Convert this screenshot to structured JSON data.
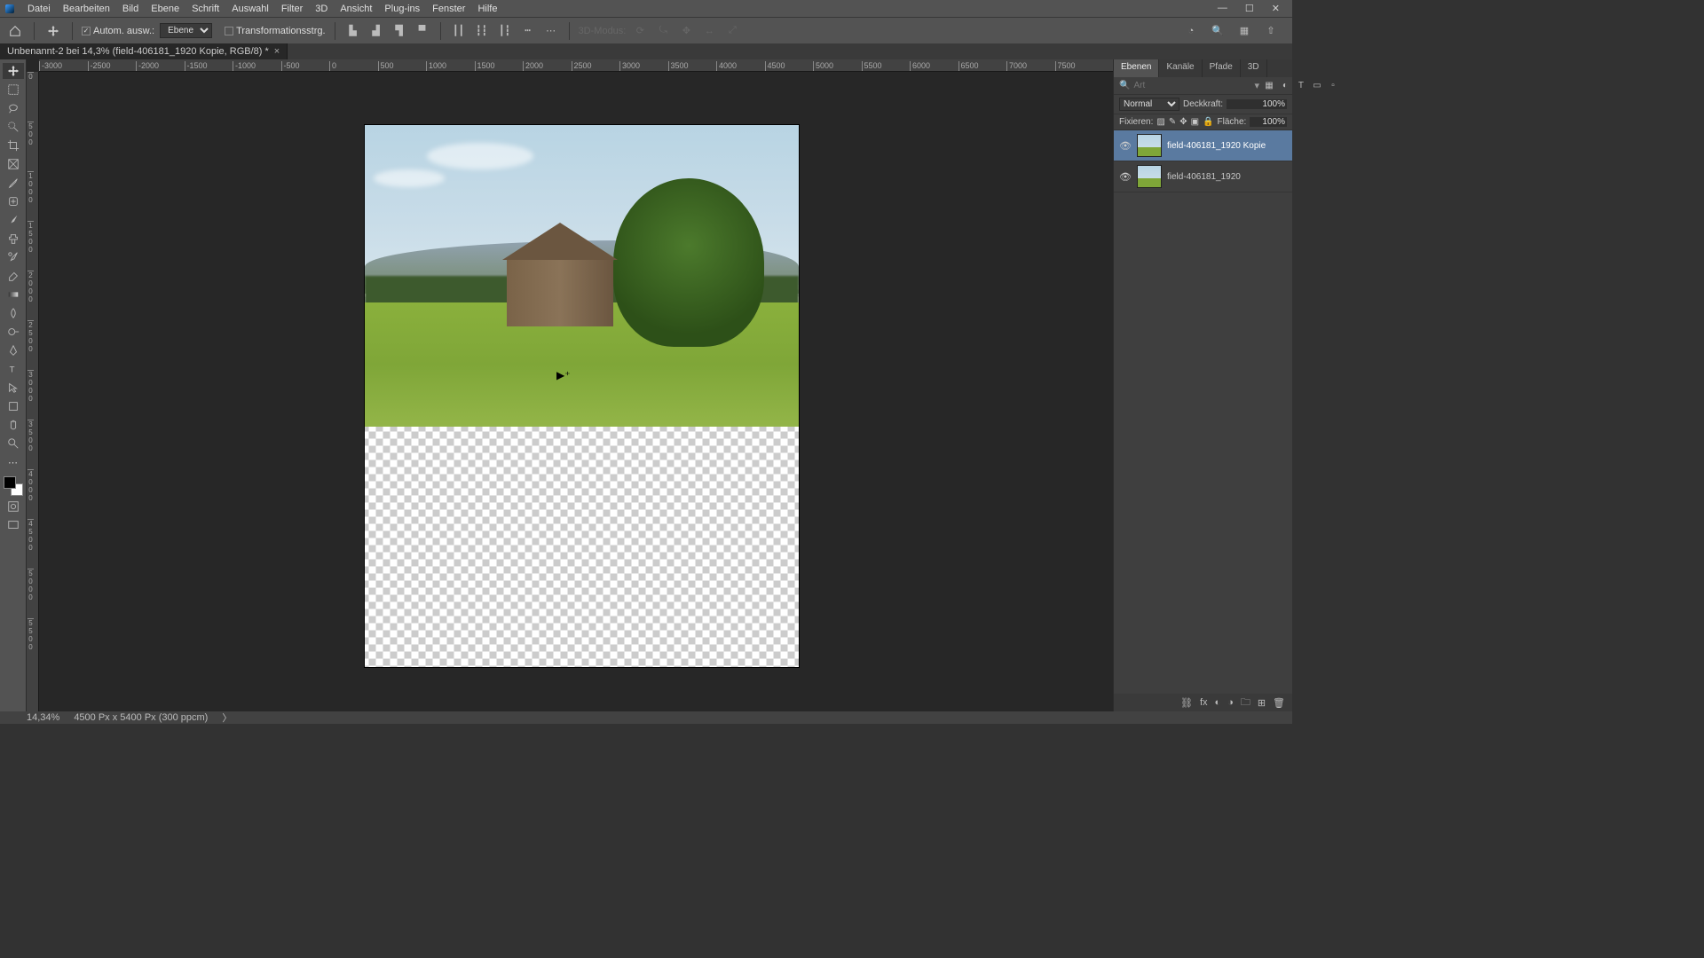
{
  "menu": {
    "items": [
      "Datei",
      "Bearbeiten",
      "Bild",
      "Ebene",
      "Schrift",
      "Auswahl",
      "Filter",
      "3D",
      "Ansicht",
      "Plug-ins",
      "Fenster",
      "Hilfe"
    ]
  },
  "options": {
    "auto_select_label": "Autom. ausw.:",
    "auto_select_target": "Ebene",
    "transform_ctrls_label": "Transformationsstrg.",
    "mode3d_label": "3D-Modus:"
  },
  "doc": {
    "tab_title": "Unbenannt-2 bei 14,3% (field-406181_1920 Kopie, RGB/8) *"
  },
  "ruler_h": [
    "-3000",
    "-2500",
    "-2000",
    "-1500",
    "-1000",
    "-500",
    "0",
    "500",
    "1000",
    "1500",
    "2000",
    "2500",
    "3000",
    "3500",
    "4000",
    "4500",
    "5000",
    "5500",
    "6000",
    "6500",
    "7000",
    "7500"
  ],
  "ruler_v": [
    "0",
    "500",
    "1000",
    "1500",
    "2000",
    "2500",
    "3000",
    "3500",
    "4000",
    "4500",
    "5000",
    "5500"
  ],
  "panels": {
    "tabs": [
      "Ebenen",
      "Kanäle",
      "Pfade",
      "3D"
    ],
    "search_placeholder": "Art",
    "blend_mode_label": "Normal",
    "opacity_label": "Deckkraft:",
    "opacity_value": "100%",
    "lock_label": "Fixieren:",
    "fill_label": "Fläche:",
    "fill_value": "100%"
  },
  "layers": [
    {
      "name": "field-406181_1920 Kopie",
      "selected": true
    },
    {
      "name": "field-406181_1920",
      "selected": false
    }
  ],
  "status": {
    "zoom": "14,34%",
    "docinfo": "4500 Px x 5400 Px (300 ppcm)"
  }
}
